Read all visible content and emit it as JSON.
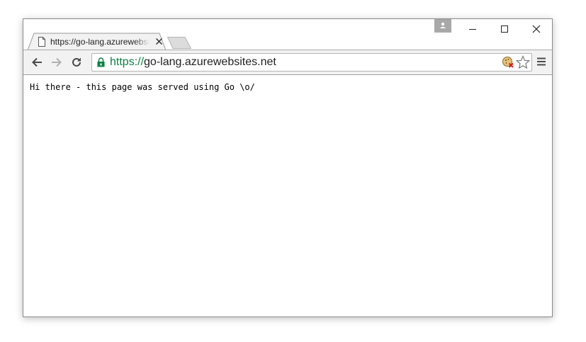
{
  "tab": {
    "title": "https://go-lang.azurewebsites.net"
  },
  "omnibox": {
    "scheme": "https://",
    "host": "go-lang.azurewebsites.net"
  },
  "page": {
    "text": "Hi there - this page was served using Go \\o/"
  },
  "colors": {
    "secure_green": "#0b8043",
    "toolbar_bg": "#f2f2f2"
  },
  "icons": [
    "page-icon",
    "close-icon",
    "back-arrow-icon",
    "forward-arrow-icon",
    "reload-icon",
    "lock-icon",
    "cookie-blocked-icon",
    "star-icon",
    "menu-icon",
    "profile-icon",
    "minimize-icon",
    "maximize-icon",
    "close-window-icon"
  ]
}
